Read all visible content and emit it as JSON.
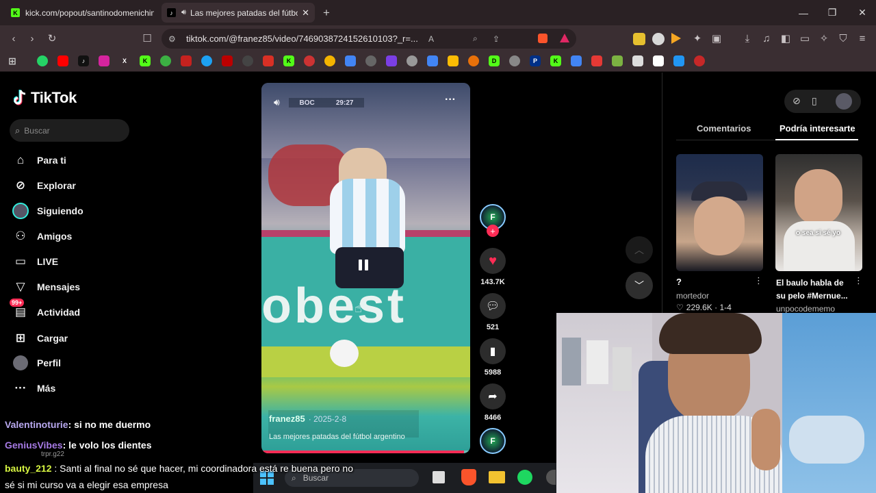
{
  "browser": {
    "tabs": [
      {
        "title": "kick.com/popout/santinodomenichini/chat",
        "active": false
      },
      {
        "title": "Las mejores patadas del fútbol argentino",
        "active": true
      }
    ],
    "new_tab": "+",
    "url": "tiktok.com/@franez85/video/7469038724152610103?_r=..."
  },
  "tiktok": {
    "logo": "TikTok",
    "search_placeholder": "Buscar",
    "nav": [
      {
        "label": "Para ti",
        "icon": "home-icon"
      },
      {
        "label": "Explorar",
        "icon": "compass-icon"
      },
      {
        "label": "Siguiendo",
        "icon": "following-icon"
      },
      {
        "label": "Amigos",
        "icon": "friends-icon"
      },
      {
        "label": "LIVE",
        "icon": "live-icon"
      },
      {
        "label": "Mensajes",
        "icon": "messages-icon"
      },
      {
        "label": "Actividad",
        "icon": "activity-icon",
        "badge": "99+"
      },
      {
        "label": "Cargar",
        "icon": "upload-icon"
      },
      {
        "label": "Perfil",
        "icon": "profile-icon"
      },
      {
        "label": "Más",
        "icon": "more-icon"
      }
    ],
    "video": {
      "author": "franez85",
      "date": "2025-2-8",
      "caption": "Las mejores patadas del fútbol argentino",
      "overlay_text": "BOC",
      "overlay_time": "29:27",
      "progress": 0.97
    },
    "actions": {
      "likes": "143.7K",
      "comments": "521",
      "saves": "5988",
      "shares": "8466"
    },
    "right": {
      "tab_comments": "Comentarios",
      "tab_interest": "Podría interesarte",
      "cards": [
        {
          "title": "?",
          "author": "mortedor",
          "stats": "229.6K · 1-4",
          "overlay": ""
        },
        {
          "title": "El baulo habla de su pelo #Mernue...",
          "author": "unpocodememo",
          "stats": "",
          "overlay": "o sea si sé yo"
        }
      ]
    }
  },
  "chat": [
    {
      "user": "Valentinoturie",
      "msg": "si no me duermo",
      "color": "#b9a9f0"
    },
    {
      "user": "GeniusVibes",
      "msg": "le volo los dientes",
      "color": "#a77be6"
    },
    {
      "user": "bauty_212",
      "msg": "Santi al final no sé que hacer, mi coordinadora está re buena pero no sé si mi curso va a elegir esa empresa",
      "color": "#d7f542"
    }
  ],
  "chat_msg3_line1": "Santi al final no sé que hacer, mi coordinadora está re buena pero no",
  "chat_msg3_line2": "sé si mi curso va a elegir esa empresa",
  "chat_faint": "trpr.g22",
  "taskbar": {
    "search": "Buscar"
  },
  "colors": {
    "accent": "#fe2c55",
    "chat_green": "#d7f542"
  }
}
